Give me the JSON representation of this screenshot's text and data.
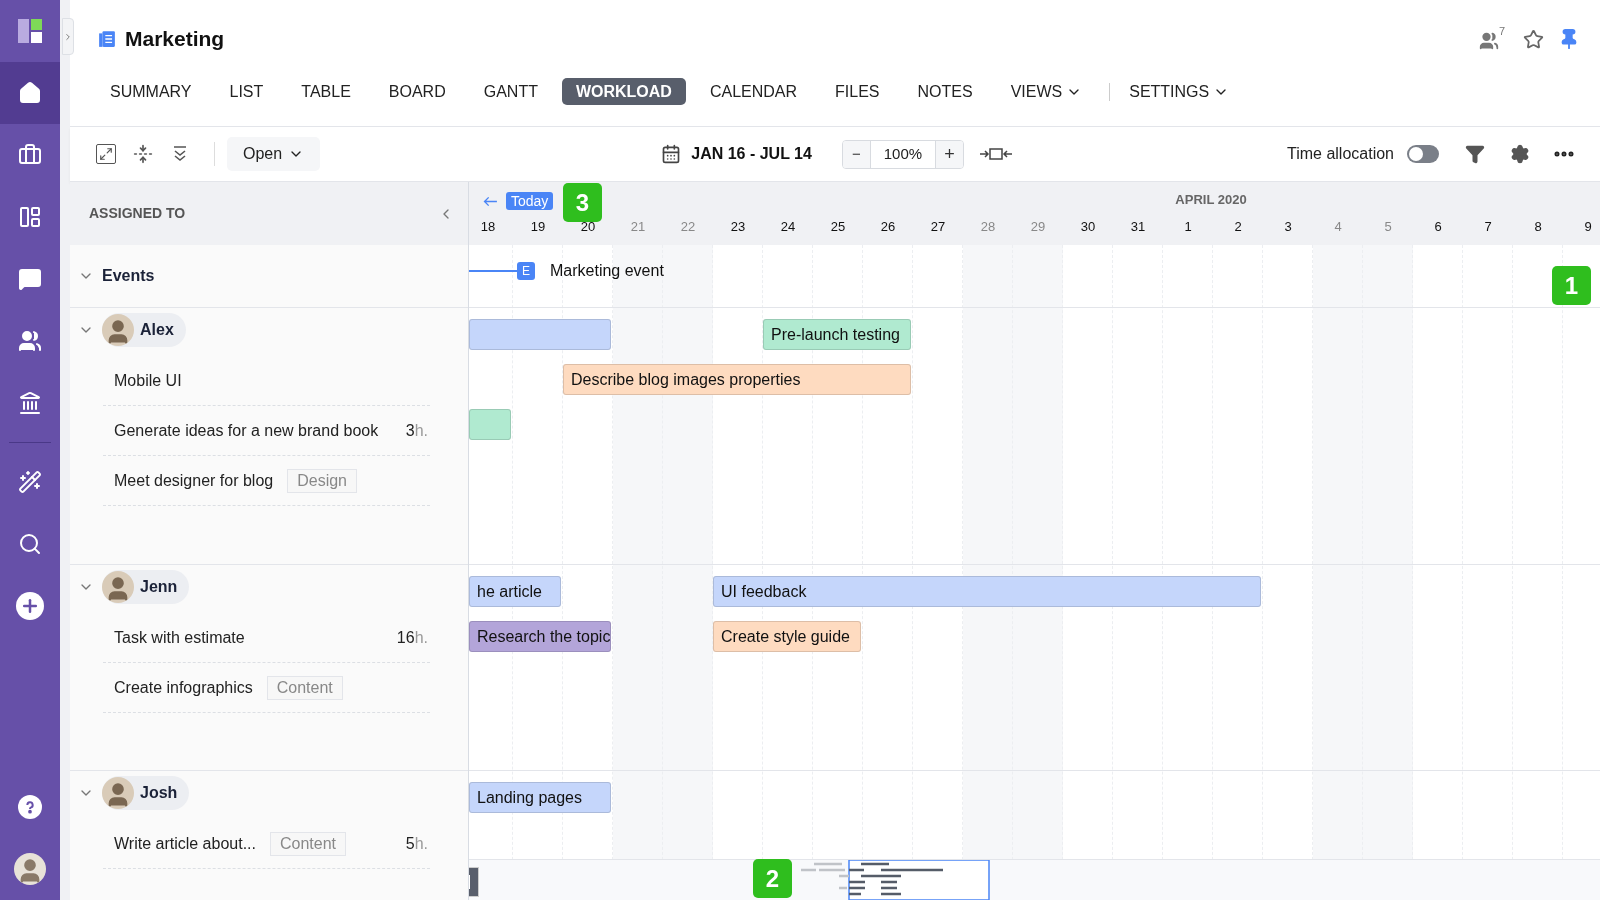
{
  "sidebar": {
    "items": [
      {
        "selected": false
      },
      {
        "selected": true
      },
      {
        "selected": false
      },
      {
        "selected": false
      },
      {
        "selected": false
      },
      {
        "selected": false
      },
      {
        "selected": false
      },
      {
        "selected": false
      },
      {
        "selected": false
      },
      {
        "selected": false
      },
      {
        "selected": false
      },
      {
        "selected": false
      }
    ]
  },
  "header": {
    "title": "Marketing",
    "followers": "7",
    "pinned": true,
    "starred": false
  },
  "tabs": [
    {
      "label": "SUMMARY",
      "selected": false
    },
    {
      "label": "LIST",
      "selected": false
    },
    {
      "label": "TABLE",
      "selected": false
    },
    {
      "label": "BOARD",
      "selected": false
    },
    {
      "label": "GANTT",
      "selected": false
    },
    {
      "label": "WORKLOAD",
      "selected": true
    },
    {
      "label": "CALENDAR",
      "selected": false
    },
    {
      "label": "FILES",
      "selected": false
    },
    {
      "label": "NOTES",
      "selected": false
    },
    {
      "label": "VIEWS",
      "selected": false,
      "kind": "menu"
    },
    {
      "label": "SETTINGS",
      "selected": false,
      "kind": "menu"
    }
  ],
  "toolbar": {
    "status": "Open",
    "range": "JAN 16 - JUL 14",
    "zoom": {
      "minus": "−",
      "value": "100%",
      "plus": "+"
    },
    "time_allocation": {
      "label": "Time allocation",
      "on": false
    }
  },
  "timeline": {
    "today": "Today",
    "month": "APRIL 2020",
    "days": [
      {
        "label": "18",
        "weekend": false
      },
      {
        "label": "19",
        "weekend": false
      },
      {
        "label": "20",
        "weekend": false
      },
      {
        "label": "21",
        "weekend": true
      },
      {
        "label": "22",
        "weekend": true
      },
      {
        "label": "23",
        "weekend": false
      },
      {
        "label": "24",
        "weekend": false
      },
      {
        "label": "25",
        "weekend": false
      },
      {
        "label": "26",
        "weekend": false
      },
      {
        "label": "27",
        "weekend": false
      },
      {
        "label": "28",
        "weekend": true
      },
      {
        "label": "29",
        "weekend": true
      },
      {
        "label": "30",
        "weekend": false
      },
      {
        "label": "31",
        "weekend": false
      },
      {
        "label": "1",
        "weekend": false
      },
      {
        "label": "2",
        "weekend": false
      },
      {
        "label": "3",
        "weekend": false
      },
      {
        "label": "4",
        "weekend": true
      },
      {
        "label": "5",
        "weekend": true
      },
      {
        "label": "6",
        "weekend": false
      },
      {
        "label": "7",
        "weekend": false
      },
      {
        "label": "8",
        "weekend": false
      },
      {
        "label": "9",
        "weekend": false
      }
    ]
  },
  "assigned_header": "ASSIGNED TO",
  "events": {
    "label": "Events",
    "expanded": true,
    "items": [
      {
        "marker": "E",
        "title": "Marketing event"
      }
    ]
  },
  "groups": [
    {
      "name": "Alex",
      "expanded": true,
      "tasks": [
        {
          "title": "Mobile UI"
        },
        {
          "title": "Generate ideas for a new brand book",
          "hours": "3",
          "unit": "h."
        },
        {
          "title": "Meet designer for blog",
          "tag": "Design"
        }
      ],
      "lanes": [
        [
          {
            "color": "#c5d6fb"
          },
          {
            "title": "Pre-launch testing",
            "color": "#b0ead0"
          }
        ],
        [
          {
            "title": "Describe blog images properties",
            "color": "#fedbc0"
          }
        ],
        [
          {
            "color": "#b0ead0"
          }
        ]
      ]
    },
    {
      "name": "Jenn",
      "expanded": true,
      "tasks": [
        {
          "title": "Task with estimate",
          "hours": "16",
          "unit": "h."
        },
        {
          "title": "Create infographics",
          "tag": "Content"
        }
      ],
      "lanes": [
        [
          {
            "title": "he article",
            "color": "#c5d6fb"
          },
          {
            "title": "UI feedback",
            "color": "#c5d6fb"
          }
        ],
        [
          {
            "title": "Research the topic",
            "color": "#b3a5d9"
          },
          {
            "title": "Create style guide",
            "color": "#fedbc0"
          }
        ]
      ]
    },
    {
      "name": "Josh",
      "expanded": true,
      "tasks": [
        {
          "title": "Write article about...",
          "tag": "Content",
          "hours": "5",
          "unit": "h."
        }
      ],
      "lanes": [
        [
          {
            "title": "Landing pages",
            "color": "#c5d6fb"
          }
        ]
      ]
    }
  ],
  "tour_markers": [
    "1",
    "2",
    "3"
  ]
}
